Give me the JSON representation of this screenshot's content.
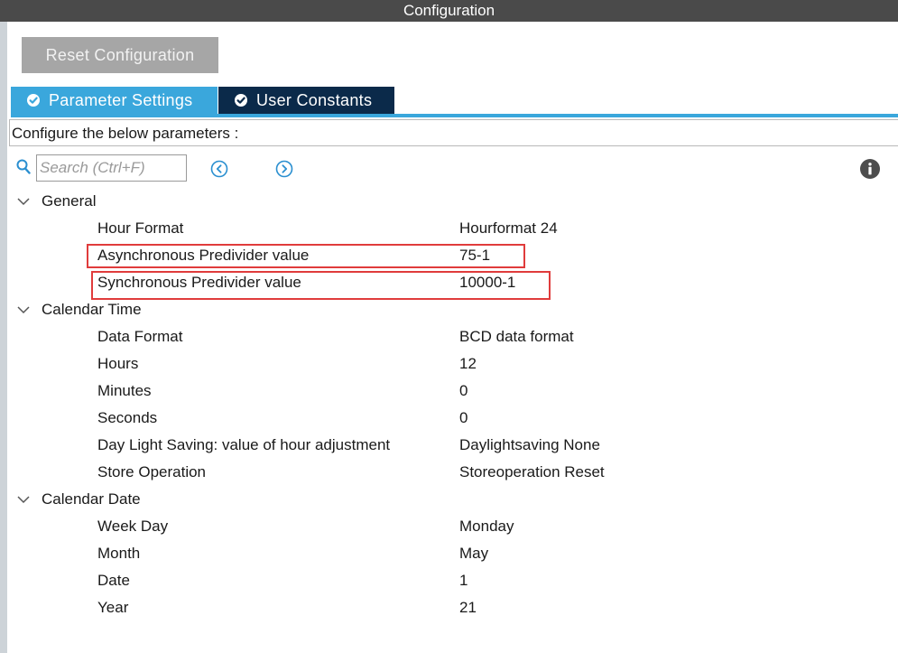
{
  "window": {
    "title": "Configuration"
  },
  "toolbar": {
    "reset_label": "Reset Configuration"
  },
  "tabs": [
    {
      "label": "Parameter Settings",
      "active": true
    },
    {
      "label": "User Constants",
      "active": false
    }
  ],
  "description": "Configure the below parameters :",
  "search": {
    "placeholder": "Search (Ctrl+F)",
    "value": ""
  },
  "icons": {
    "search": "search-icon",
    "prev": "circle-chevron-left-icon",
    "next": "circle-chevron-right-icon",
    "info": "info-icon",
    "expand": "chevron-down-icon",
    "tab_check": "check-circle-icon"
  },
  "colors": {
    "active_tab": "#3aa7dc",
    "inactive_tab": "#0b2a4a",
    "highlight": "#e03c3c",
    "title_bar": "#4a4a4a",
    "button": "#a6a6a6"
  },
  "groups": [
    {
      "name": "General",
      "expanded": true,
      "params": [
        {
          "label": "Hour Format",
          "value": "Hourformat 24"
        },
        {
          "label": "Asynchronous Predivider value",
          "value": "75-1",
          "highlighted": true
        },
        {
          "label": "Synchronous Predivider value",
          "value": "10000-1",
          "highlighted": true
        }
      ]
    },
    {
      "name": "Calendar Time",
      "expanded": true,
      "params": [
        {
          "label": "Data Format",
          "value": "BCD data format"
        },
        {
          "label": "Hours",
          "value": "12"
        },
        {
          "label": "Minutes",
          "value": "0"
        },
        {
          "label": "Seconds",
          "value": "0"
        },
        {
          "label": "Day Light Saving: value of hour adjustment",
          "value": "Daylightsaving None"
        },
        {
          "label": "Store Operation",
          "value": "Storeoperation Reset"
        }
      ]
    },
    {
      "name": "Calendar Date",
      "expanded": true,
      "params": [
        {
          "label": "Week Day",
          "value": "Monday"
        },
        {
          "label": "Month",
          "value": "May"
        },
        {
          "label": "Date",
          "value": "1"
        },
        {
          "label": "Year",
          "value": "21"
        }
      ]
    }
  ]
}
